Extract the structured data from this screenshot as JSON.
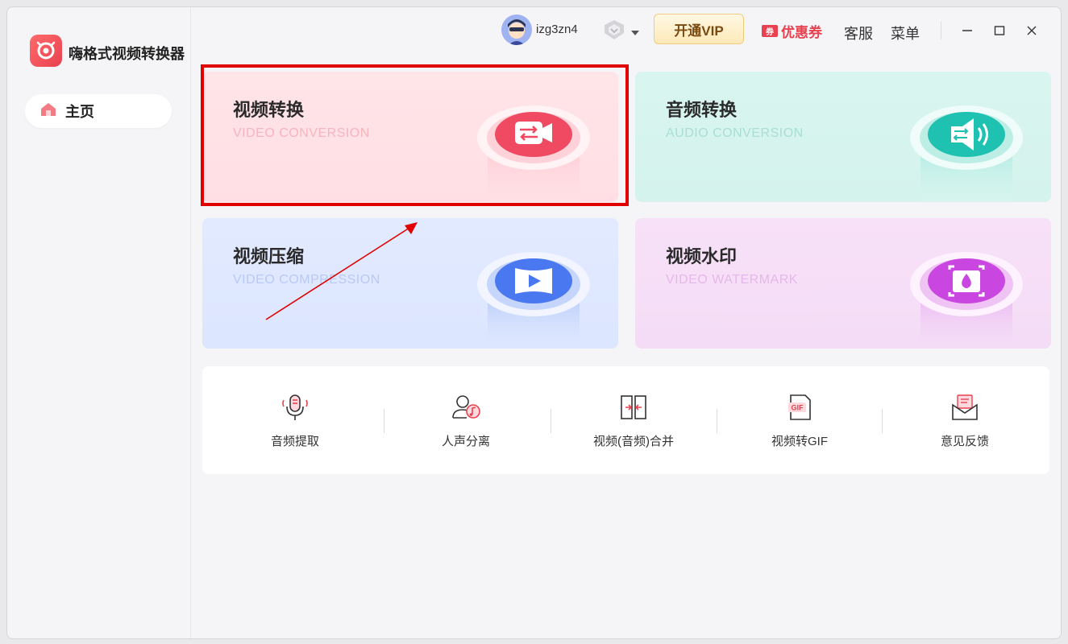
{
  "app": {
    "title": "嗨格式视频转换器"
  },
  "sidebar": {
    "items": [
      {
        "label": "主页",
        "icon": "home-icon"
      }
    ]
  },
  "header": {
    "username": "izg3zn4",
    "vip_label": "开通VIP",
    "coupon_label": "优惠券",
    "coupon_badge": "券",
    "service_label": "客服",
    "menu_label": "菜单"
  },
  "cards": [
    {
      "title": "视频转换",
      "subtitle": "VIDEO CONVERSION",
      "icon": "video-convert-icon",
      "accent": "#f04a62"
    },
    {
      "title": "音频转换",
      "subtitle": "AUDIO CONVERSION",
      "icon": "audio-convert-icon",
      "accent": "#1fc1b0"
    },
    {
      "title": "视频压缩",
      "subtitle": "VIDEO COMPRESSION",
      "icon": "video-compress-icon",
      "accent": "#4a78f0"
    },
    {
      "title": "视频水印",
      "subtitle": "VIDEO WATERMARK",
      "icon": "video-watermark-icon",
      "accent": "#c947e0"
    }
  ],
  "tools": [
    {
      "label": "音频提取",
      "icon": "microphone-icon"
    },
    {
      "label": "人声分离",
      "icon": "voice-separate-icon"
    },
    {
      "label": "视频(音频)合并",
      "icon": "merge-icon"
    },
    {
      "label": "视频转GIF",
      "icon": "gif-icon"
    },
    {
      "label": "意见反馈",
      "icon": "feedback-icon"
    }
  ],
  "colors": {
    "highlight": "#e00000",
    "brand": "#e8414f",
    "vip_text": "#7a4a10"
  }
}
